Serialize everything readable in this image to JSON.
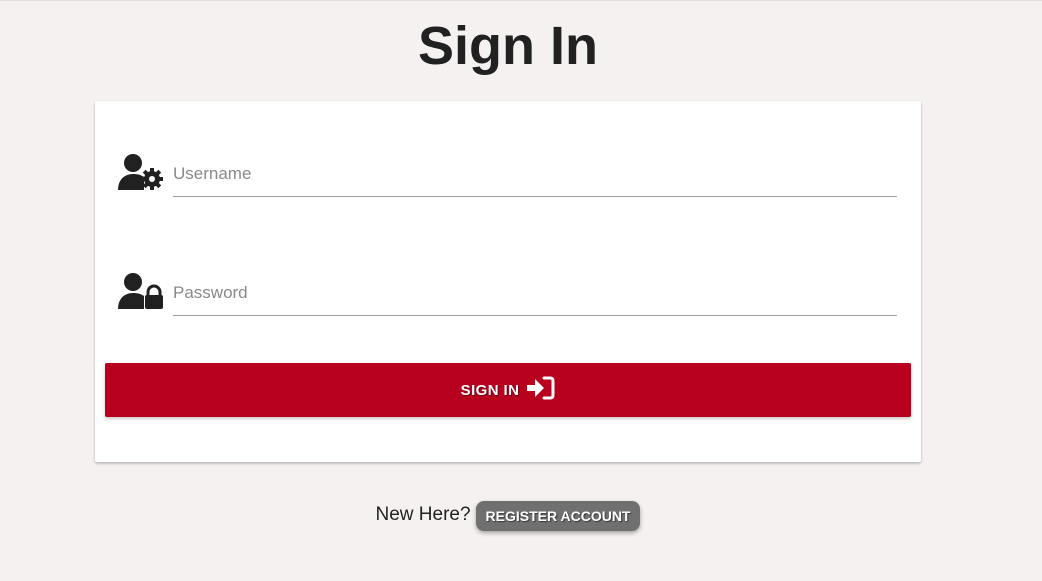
{
  "page": {
    "title": "Sign In"
  },
  "form": {
    "username": {
      "placeholder": "Username",
      "value": "",
      "icon": "user-cog-icon"
    },
    "password": {
      "placeholder": "Password",
      "value": "",
      "icon": "user-lock-icon"
    },
    "submit": {
      "label": "Sign In",
      "icon": "sign-in-icon"
    }
  },
  "footer": {
    "prompt": "New Here?",
    "register_label": "Register Account"
  },
  "colors": {
    "background": "#f6f1f1",
    "primary": "#b8001f",
    "secondary_button": "#707070",
    "text": "#212121"
  }
}
